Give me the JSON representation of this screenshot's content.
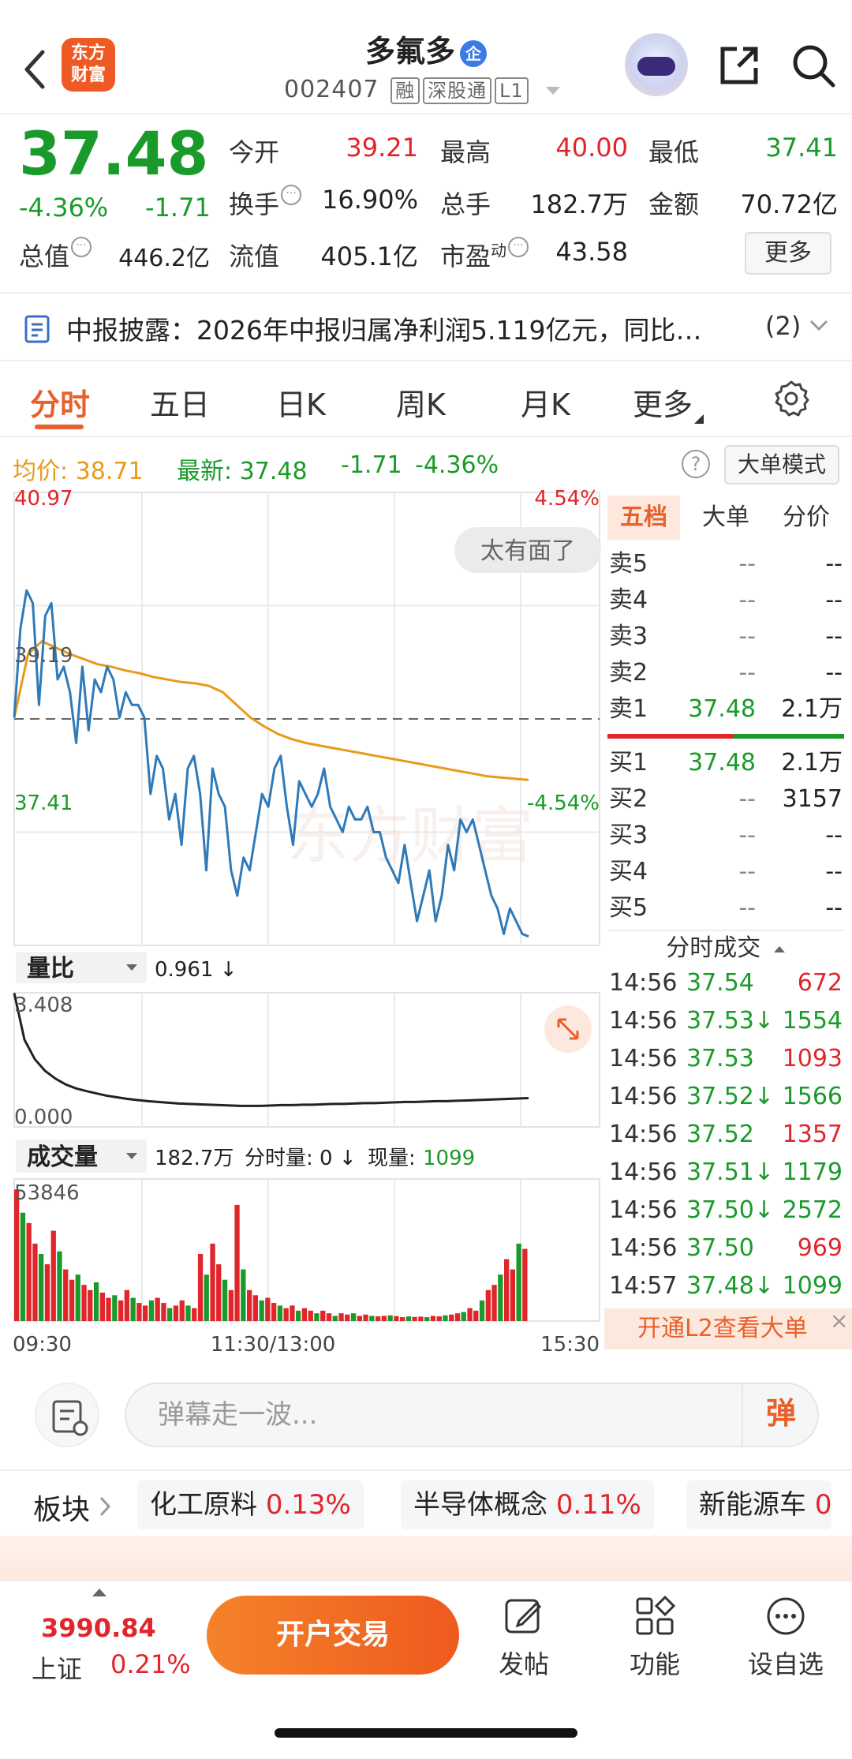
{
  "header": {
    "logo_line1": "东方",
    "logo_line2": "财富",
    "stock_name": "多氟多",
    "qi_badge": "企",
    "stock_code": "002407",
    "tags": [
      "融",
      "深股通",
      "L1"
    ]
  },
  "quote": {
    "price": "37.48",
    "change_pct": "-4.36%",
    "change_amt": "-1.71",
    "stats": [
      {
        "label": "今开",
        "value": "39.21",
        "color": "red"
      },
      {
        "label": "最高",
        "value": "40.00",
        "color": "red"
      },
      {
        "label": "最低",
        "value": "37.41",
        "color": "green"
      },
      {
        "label": "换手",
        "value": "16.90%",
        "color": "dark"
      },
      {
        "label": "总手",
        "value": "182.7万",
        "color": "dark"
      },
      {
        "label": "金额",
        "value": "70.72亿",
        "color": "dark"
      },
      {
        "label": "总值",
        "value": "446.2亿",
        "color": "dark"
      },
      {
        "label": "流值",
        "value": "405.1亿",
        "color": "dark"
      },
      {
        "label": "市盈",
        "value": "43.58",
        "color": "dark"
      }
    ],
    "pe_sup": "动",
    "more_label": "更多"
  },
  "news": {
    "text": "中报披露：2026年中报归属净利润5.119亿元，同比…",
    "count": "(2)"
  },
  "tabs": [
    {
      "label": "分时",
      "active": true
    },
    {
      "label": "五日",
      "active": false
    },
    {
      "label": "日K",
      "active": false
    },
    {
      "label": "周K",
      "active": false
    },
    {
      "label": "月K",
      "active": false
    },
    {
      "label": "更多",
      "active": false
    }
  ],
  "chart_head": {
    "avg_label": "均价: 38.71",
    "latest_label": "最新: 37.48",
    "latest_chg": "-1.71",
    "latest_pct": "-4.36%",
    "help": "?",
    "bigorder_btn": "大单模式"
  },
  "chart": {
    "price_high": "40.97",
    "price_low": "37.41",
    "pct_high": "4.54%",
    "pct_low": "-4.54%",
    "prev_close": "39.19",
    "watermark": "东方财富",
    "reaction_bubble": "太有面了",
    "vr_selector": "量比",
    "vr_value": "0.961 ↓",
    "vr_max": "3.408",
    "vr_min": "0.000",
    "vol_selector": "成交量",
    "vol_info_total": "182.7万",
    "vol_info_fen": "分时量: 0 ↓",
    "vol_info_now_label": "现量:",
    "vol_info_now": "1099",
    "vol_max": "53846",
    "time_labels": [
      "09:30",
      "11:30/13:00",
      "15:30"
    ]
  },
  "chart_data": {
    "type": "line",
    "series": [
      {
        "name": "最新",
        "color": "#2f7ab8"
      },
      {
        "name": "均价",
        "color": "#e89b1a"
      }
    ],
    "ylim": [
      37.41,
      40.97
    ],
    "prev_close": 39.19,
    "price": [
      39.2,
      39.9,
      40.2,
      40.1,
      39.3,
      40.0,
      40.1,
      39.5,
      39.6,
      39.4,
      39.0,
      39.6,
      39.1,
      39.5,
      39.4,
      39.6,
      39.5,
      39.2,
      39.4,
      39.3,
      39.3,
      39.2,
      38.6,
      38.9,
      38.8,
      38.4,
      38.6,
      38.2,
      38.8,
      38.9,
      38.6,
      38.0,
      38.8,
      38.6,
      38.5,
      38.0,
      37.8,
      38.1,
      38.0,
      38.3,
      38.6,
      38.5,
      38.8,
      38.9,
      38.5,
      38.2,
      38.7,
      38.6,
      38.5,
      38.6,
      38.8,
      38.5,
      38.4,
      38.3,
      38.5,
      38.4,
      38.4,
      38.5,
      38.3,
      38.3,
      38.1,
      38.0,
      37.9,
      38.2,
      37.9,
      37.6,
      37.8,
      38.0,
      37.6,
      37.8,
      38.2,
      38.0,
      38.4,
      38.3,
      38.4,
      38.2,
      38.0,
      37.8,
      37.7,
      37.5,
      37.7,
      37.6,
      37.5,
      37.48
    ],
    "avg": [
      39.2,
      39.7,
      39.8,
      39.75,
      39.7,
      39.66,
      39.62,
      39.6,
      39.57,
      39.55,
      39.52,
      39.5,
      39.48,
      39.47,
      39.45,
      39.4,
      39.3,
      39.2,
      39.13,
      39.07,
      39.03,
      39.0,
      38.98,
      38.96,
      38.94,
      38.92,
      38.9,
      38.88,
      38.86,
      38.84,
      38.82,
      38.8,
      38.78,
      38.76,
      38.74,
      38.73,
      38.72,
      38.71
    ],
    "volume_ratio": {
      "ylim": [
        0,
        3.408
      ],
      "values": [
        3.4,
        2.2,
        1.7,
        1.4,
        1.2,
        1.05,
        0.95,
        0.88,
        0.82,
        0.76,
        0.72,
        0.68,
        0.65,
        0.62,
        0.6,
        0.58,
        0.56,
        0.55,
        0.54,
        0.53,
        0.52,
        0.51,
        0.5,
        0.5,
        0.5,
        0.51,
        0.52,
        0.52,
        0.53,
        0.53,
        0.54,
        0.55,
        0.55,
        0.56,
        0.57,
        0.57,
        0.58,
        0.59,
        0.6,
        0.6,
        0.61,
        0.62,
        0.62,
        0.63,
        0.64,
        0.65,
        0.66,
        0.67,
        0.68,
        0.69,
        0.7
      ]
    },
    "volume": {
      "ylim": [
        0,
        53846
      ],
      "values": [
        51000,
        42000,
        38000,
        30000,
        26000,
        22000,
        35000,
        27000,
        20000,
        16000,
        18000,
        14000,
        12000,
        15000,
        11000,
        9000,
        10000,
        8000,
        12000,
        9000,
        7000,
        6000,
        8000,
        9000,
        7000,
        5000,
        6000,
        8000,
        6000,
        5000,
        26000,
        18000,
        30000,
        22000,
        16000,
        12000,
        45000,
        20000,
        12000,
        10000,
        8000,
        9000,
        7000,
        6000,
        5000,
        6000,
        4000,
        5000,
        4000,
        3000,
        4000,
        3000,
        2000,
        3000,
        2500,
        3000,
        2000,
        2500,
        2000,
        1800,
        2000,
        2200,
        1900,
        1500,
        1800,
        1600,
        1700,
        1500,
        2000,
        1800,
        2200,
        2500,
        3000,
        3500,
        5000,
        4000,
        8000,
        12000,
        14000,
        18000,
        24000,
        20000,
        30000,
        28000
      ]
    }
  },
  "panel": {
    "tabs": [
      "五档",
      "大单",
      "分价"
    ],
    "asks": [
      {
        "label": "卖5",
        "price": "--",
        "vol": "--",
        "pcolor": "gray"
      },
      {
        "label": "卖4",
        "price": "--",
        "vol": "--",
        "pcolor": "gray"
      },
      {
        "label": "卖3",
        "price": "--",
        "vol": "--",
        "pcolor": "gray"
      },
      {
        "label": "卖2",
        "price": "--",
        "vol": "--",
        "pcolor": "gray"
      },
      {
        "label": "卖1",
        "price": "37.48",
        "vol": "2.1万",
        "pcolor": "green"
      }
    ],
    "bids": [
      {
        "label": "买1",
        "price": "37.48",
        "vol": "2.1万",
        "pcolor": "green"
      },
      {
        "label": "买2",
        "price": "--",
        "vol": "3157",
        "pcolor": "gray"
      },
      {
        "label": "买3",
        "price": "--",
        "vol": "--",
        "pcolor": "gray"
      },
      {
        "label": "买4",
        "price": "--",
        "vol": "--",
        "pcolor": "gray"
      },
      {
        "label": "买5",
        "price": "--",
        "vol": "--",
        "pcolor": "gray"
      }
    ],
    "trades_title": "分时成交",
    "trades": [
      {
        "time": "14:56",
        "price": "37.54",
        "vol": "672",
        "vcolor": "red"
      },
      {
        "time": "14:56",
        "price": "37.53↓",
        "vol": "1554",
        "vcolor": "green"
      },
      {
        "time": "14:56",
        "price": "37.53",
        "vol": "1093",
        "vcolor": "red"
      },
      {
        "time": "14:56",
        "price": "37.52↓",
        "vol": "1566",
        "vcolor": "green"
      },
      {
        "time": "14:56",
        "price": "37.52",
        "vol": "1357",
        "vcolor": "red"
      },
      {
        "time": "14:56",
        "price": "37.51↓",
        "vol": "1179",
        "vcolor": "green"
      },
      {
        "time": "14:56",
        "price": "37.50↓",
        "vol": "2572",
        "vcolor": "green"
      },
      {
        "time": "14:56",
        "price": "37.50",
        "vol": "969",
        "vcolor": "red"
      },
      {
        "time": "14:57",
        "price": "37.48↓",
        "vol": "1099",
        "vcolor": "green"
      }
    ],
    "l2_promo": "开通L2查看大单",
    "l2_close": "×"
  },
  "danmu": {
    "placeholder": "弹幕走一波...",
    "button": "弹"
  },
  "sectors": {
    "label": "板块",
    "items": [
      {
        "name": "化工原料",
        "pct": "0.13%"
      },
      {
        "name": "半导体概念",
        "pct": "0.11%"
      },
      {
        "name": "新能源车",
        "pct": "0"
      }
    ]
  },
  "bottom_nav": {
    "index_value": "3990.84",
    "index_name": "上证",
    "index_pct": "0.21%",
    "open_trade": "开户交易",
    "items": [
      "发帖",
      "功能",
      "设自选"
    ]
  },
  "colors": {
    "accent": "#e8602c",
    "up": "#e0252b",
    "down": "#1a9a2a",
    "avg_line": "#e89b1a",
    "price_line": "#2f7ab8"
  }
}
